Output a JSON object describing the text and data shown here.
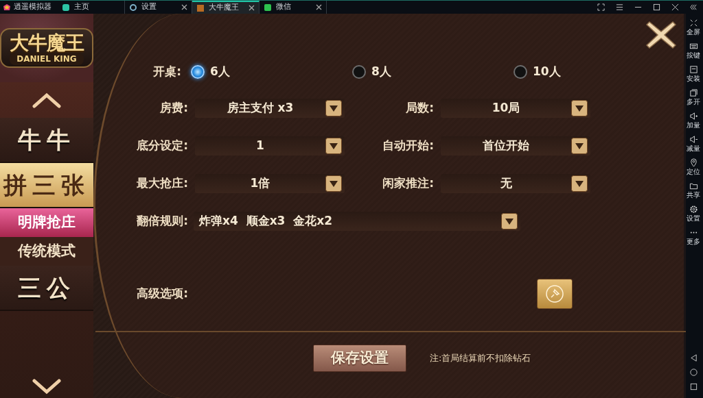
{
  "title_bar": {
    "app_name": "逍遥模拟器",
    "tabs": [
      {
        "label": "主页",
        "selected": false,
        "closable": false
      },
      {
        "label": "设置",
        "selected": false,
        "closable": true
      },
      {
        "label": "大牛魔王",
        "selected": true,
        "closable": true
      },
      {
        "label": "微信",
        "selected": false,
        "closable": true
      }
    ]
  },
  "game": {
    "logo": {
      "title": "大牛魔王",
      "subtitle": "DANIEL KING"
    },
    "menu": [
      {
        "label": "牛牛",
        "selected": false
      },
      {
        "label": "拼三张",
        "selected": true,
        "children": [
          {
            "label": "明牌抢庄",
            "selected": true
          },
          {
            "label": "传统模式",
            "selected": false
          }
        ]
      },
      {
        "label": "三公",
        "selected": false
      }
    ],
    "table_size": {
      "label": "开桌:",
      "options": [
        {
          "label": "6人",
          "selected": true
        },
        {
          "label": "8人",
          "selected": false
        },
        {
          "label": "10人",
          "selected": false
        }
      ]
    },
    "fields": [
      {
        "label": "房费:",
        "value": "房主支付 x3"
      },
      {
        "label": "局数:",
        "value": "10局"
      },
      {
        "label": "底分设定:",
        "value": "1"
      },
      {
        "label": "自动开始:",
        "value": "首位开始"
      },
      {
        "label": "最大抢庄:",
        "value": "1倍"
      },
      {
        "label": "闲家推注:",
        "value": "无"
      }
    ],
    "multiplier_rule": {
      "label": "翻倍规则:",
      "value": "炸弹x4  顺金x3  金花x2"
    },
    "advanced": {
      "label": "高级选项:"
    },
    "save_button": "保存设置",
    "note": "注:首局结算前不扣除钻石"
  },
  "side_toolbar": [
    {
      "kind": "fullscreen",
      "label": "全屏"
    },
    {
      "kind": "keyboard",
      "label": "按键"
    },
    {
      "kind": "install",
      "label": "安装"
    },
    {
      "kind": "multi",
      "label": "多开"
    },
    {
      "kind": "volup",
      "label": "加量"
    },
    {
      "kind": "voldown",
      "label": "减量"
    },
    {
      "kind": "location",
      "label": "定位"
    },
    {
      "kind": "share",
      "label": "共享"
    },
    {
      "kind": "settings",
      "label": "设置"
    },
    {
      "kind": "more",
      "label": "更多"
    }
  ]
}
